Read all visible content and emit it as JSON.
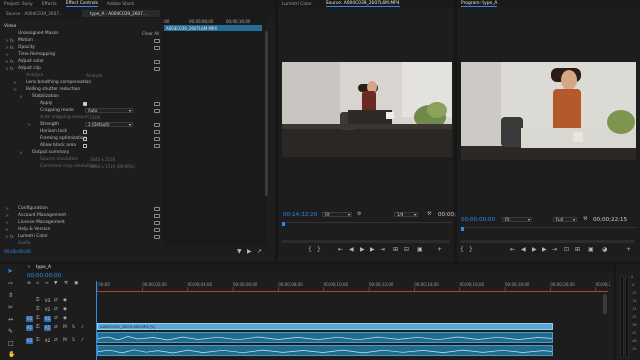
{
  "effect_controls": {
    "tabs": [
      "Project: Sony",
      "Effects",
      "Effect Controls",
      "Adobe Stock"
    ],
    "source_label": "Source · A004C039_2607...",
    "clip_label": "type_A · A004C039_2607...",
    "header_ruler": [
      ":00",
      "00;00;08;00",
      "00;00;16;00"
    ],
    "clip_bar": "A004C039_2607L6M.MP4",
    "video_label": "Video",
    "rows": [
      {
        "tw": "",
        "fx": "",
        "label": "Unassigned Masks",
        "extra": "Clear All"
      },
      {
        "tw": ">",
        "fx": "fx",
        "label": "Motion"
      },
      {
        "tw": ">",
        "fx": "fx",
        "label": "Opacity"
      },
      {
        "tw": ">",
        "fx": "",
        "label": "Time Remapping"
      },
      {
        "tw": ">",
        "fx": "fx",
        "label": "Adjust color"
      },
      {
        "tw": "v",
        "fx": "fx",
        "label": "Adjust clip"
      },
      {
        "tw": "",
        "fx": "",
        "label": "Analyze",
        "extra": "Analyze",
        "dim": true
      },
      {
        "tw": ">",
        "fx": "",
        "label": "Lens breathing compensation"
      },
      {
        "tw": ">",
        "fx": "",
        "label": "Rolling shutter reduction"
      },
      {
        "tw": "v",
        "fx": "",
        "label": "Stabilization"
      },
      {
        "tw": "",
        "fx": "",
        "label": "Apply",
        "control": "checkbox-on"
      },
      {
        "tw": "",
        "fx": "",
        "label": "Cropping mode",
        "control": "select",
        "value": "Auto"
      },
      {
        "tw": "",
        "fx": "",
        "label": "Auto cropping amount",
        "value": "2100",
        "dim": true
      },
      {
        "tw": ">",
        "fx": "",
        "label": "Strength",
        "control": "select",
        "value": "3 (Default)"
      },
      {
        "tw": "",
        "fx": "",
        "label": "Horizon lock",
        "control": "checkbox"
      },
      {
        "tw": "",
        "fx": "",
        "label": "Framing optimization",
        "control": "checkbox"
      },
      {
        "tw": "",
        "fx": "",
        "label": "Allow black area",
        "control": "checkbox"
      },
      {
        "tw": "v",
        "fx": "",
        "label": "Output summary"
      },
      {
        "tw": "",
        "fx": "",
        "label": "Source resolution",
        "value": "3840 x 2160",
        "dim": true
      },
      {
        "tw": "",
        "fx": "",
        "label": "Corrected crop resolution",
        "value": "2694 x 1519 (69.90%)",
        "dim": true
      },
      {
        "tw": "",
        "fx": "",
        "label": ""
      },
      {
        "tw": "",
        "fx": "",
        "label": ""
      },
      {
        "tw": "",
        "fx": "",
        "label": ""
      },
      {
        "tw": "",
        "fx": "",
        "label": ""
      },
      {
        "tw": "",
        "fx": "",
        "label": ""
      },
      {
        "tw": ">",
        "fx": "",
        "label": "Configuration"
      },
      {
        "tw": ">",
        "fx": "",
        "label": "Account Management"
      },
      {
        "tw": ">",
        "fx": "",
        "label": "License Management"
      },
      {
        "tw": ">",
        "fx": "",
        "label": "Help & Version"
      },
      {
        "tw": ">",
        "fx": "fx",
        "label": "Lumetri Color"
      },
      {
        "tw": "",
        "fx": "",
        "label": "Audio",
        "dim": true
      }
    ],
    "bottom_timecode": "00;00;00;00"
  },
  "source_monitor": {
    "tabs": [
      "Lumetri Color",
      "Source: A004C039_2607L6M.MP4"
    ],
    "timecode": "00;14;32;20",
    "fit": "Fit",
    "resolution": "1/4",
    "end_timecode": "00;00;"
  },
  "program_monitor": {
    "tabs": [
      "Program: type_A"
    ],
    "timecode": "00;00;00;00",
    "fit": "Fit",
    "quality": "Full",
    "end_timecode": "00;00;22;15"
  },
  "timeline": {
    "tab": "type_A",
    "timecode": "00;00;00;00",
    "ruler": [
      ":00;00",
      "00;00;02;00",
      "00;00;04;00",
      "00;00;06;00",
      "00;00;08;00",
      "00;00;10;00",
      "00;00;12;00",
      "00;00;14;00",
      "00;00;16;00",
      "00;00;18;00",
      "00;00;20;00",
      "00;00;22;00"
    ],
    "tracks": [
      {
        "name": "V3",
        "target": ""
      },
      {
        "name": "V2",
        "target": ""
      },
      {
        "name": "V1",
        "target": "V1"
      },
      {
        "name": "A1",
        "target": "A1"
      },
      {
        "name": "A2",
        "target": "A2"
      }
    ],
    "video_clip": "A004C039_2607L6M.MP4 [V]",
    "meter_ticks": [
      "0",
      "-6",
      "-12",
      "-18",
      "-24",
      "-30",
      "-36",
      "-42",
      "-48",
      "-54"
    ]
  },
  "colors": {
    "accent": "#2d8ceb",
    "clip_video": "#5aa7d6",
    "clip_audio": "#1f6c8f"
  }
}
